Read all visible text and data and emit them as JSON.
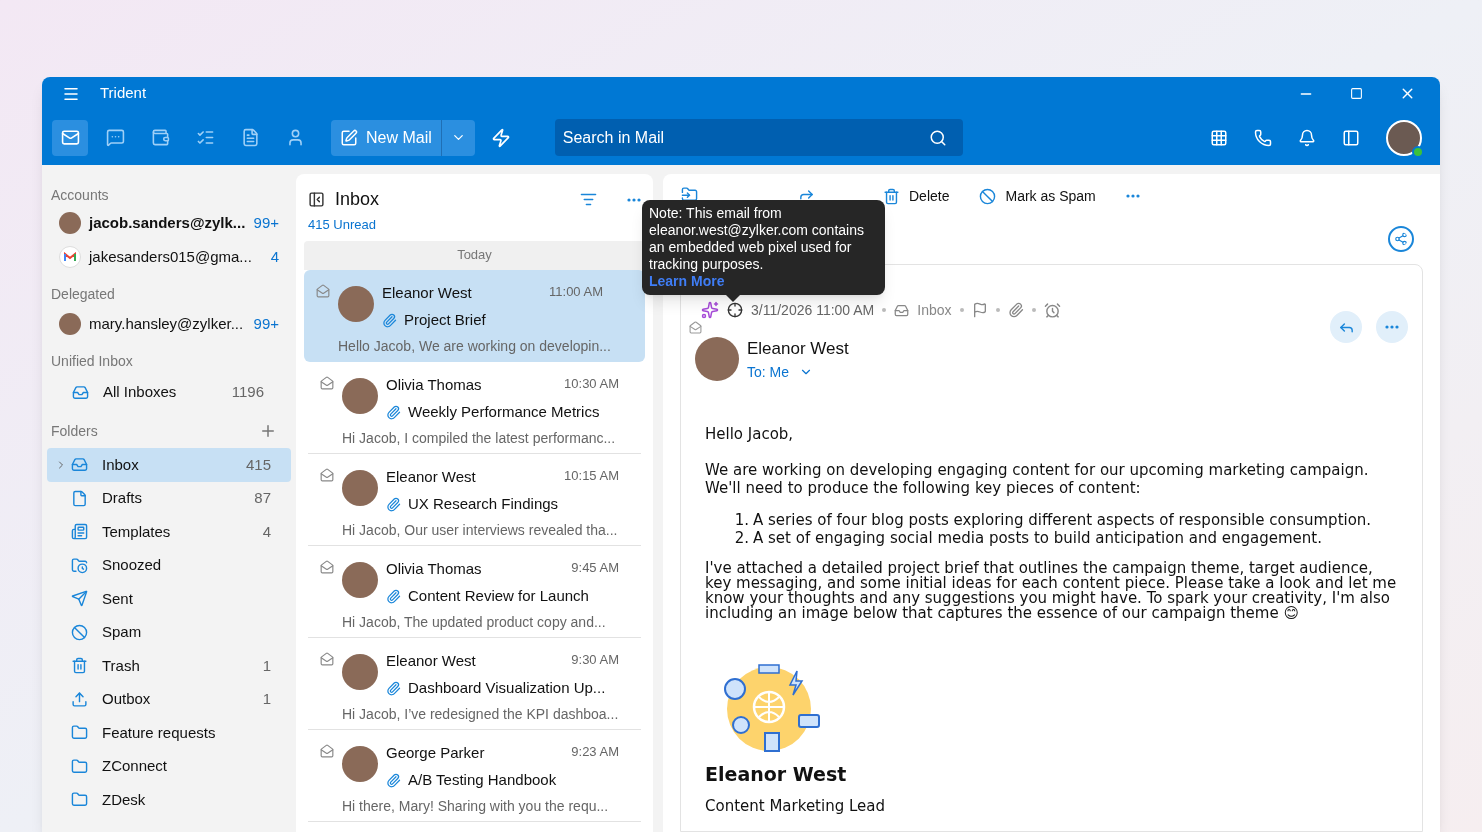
{
  "window": {
    "title": "Trident"
  },
  "toolbar": {
    "apps": [
      {
        "kind": "mail",
        "selected": true
      },
      {
        "kind": "chat",
        "selected": false
      },
      {
        "kind": "wallet",
        "selected": false
      },
      {
        "kind": "tasks",
        "selected": false
      },
      {
        "kind": "notes",
        "selected": false
      },
      {
        "kind": "contacts",
        "selected": false
      }
    ],
    "new_mail": "New Mail",
    "search": {
      "placeholder": "Search in Mail"
    }
  },
  "sidebar": {
    "accounts_heading": "Accounts",
    "accounts": [
      {
        "kind": "avatar",
        "email": "jacob.sanders@zylk...",
        "count": "99+",
        "bold": true
      },
      {
        "kind": "gmail",
        "email": "jakesanders015@gma...",
        "count": "4",
        "bold": false
      }
    ],
    "delegated_heading": "Delegated",
    "delegated": [
      {
        "kind": "avatar",
        "email": "mary.hansley@zylker...",
        "count": "99+",
        "bold": false
      }
    ],
    "unified_heading": "Unified Inbox",
    "unified": [
      {
        "label": "All Inboxes",
        "count": "1196"
      }
    ],
    "folders_heading": "Folders",
    "folders": [
      {
        "kind": "inbox",
        "label": "Inbox",
        "count": "415",
        "selected": true
      },
      {
        "kind": "drafts",
        "label": "Drafts",
        "count": "87",
        "selected": false
      },
      {
        "kind": "templates",
        "label": "Templates",
        "count": "4",
        "selected": false
      },
      {
        "kind": "snoozed",
        "label": "Snoozed",
        "selected": false
      },
      {
        "kind": "sent",
        "label": "Sent",
        "selected": false
      },
      {
        "kind": "spam",
        "label": "Spam",
        "selected": false
      },
      {
        "kind": "trash",
        "label": "Trash",
        "count": "1",
        "selected": false
      },
      {
        "kind": "outbox",
        "label": "Outbox",
        "count": "1",
        "selected": false
      },
      {
        "kind": "folder",
        "label": "Feature requests",
        "selected": false
      },
      {
        "kind": "folder",
        "label": "ZConnect",
        "selected": false
      },
      {
        "kind": "folder",
        "label": "ZDesk",
        "selected": false
      }
    ]
  },
  "mail_list": {
    "title": "Inbox",
    "unread": "415 Unread",
    "group": "Today",
    "messages": [
      {
        "sender": "Eleanor West",
        "time": "11:00 AM",
        "subject": "Project Brief",
        "preview": "Hello Jacob, We are working on developin...",
        "selected": true
      },
      {
        "sender": "Olivia Thomas",
        "time": "10:30 AM",
        "subject": "Weekly Performance Metrics",
        "preview": "Hi Jacob, I compiled the latest performanc...",
        "selected": false
      },
      {
        "sender": "Eleanor West",
        "time": "10:15 AM",
        "subject": "UX Research Findings",
        "preview": "Hi Jacob, Our user interviews revealed tha...",
        "selected": false
      },
      {
        "sender": "Olivia Thomas",
        "time": "9:45 AM",
        "subject": "Content Review for Launch",
        "preview": "Hi Jacob, The updated product copy and...",
        "selected": false
      },
      {
        "sender": "Eleanor West",
        "time": "9:30 AM",
        "subject": "Dashboard Visualization Up...",
        "preview": "Hi Jacob, I’ve redesigned the KPI dashboa...",
        "selected": false
      },
      {
        "sender": "George Parker",
        "time": "9:23 AM",
        "subject": "A/B Testing Handbook",
        "preview": "Hi there, Mary! Sharing with you the requ...",
        "selected": false
      }
    ]
  },
  "reader": {
    "actions": [
      {
        "kind": "delete",
        "label": "Delete"
      },
      {
        "kind": "spam",
        "label": "Mark as Spam"
      }
    ],
    "date": "3/11/2026 11:00 AM",
    "folder": "Inbox",
    "sender": "Eleanor West",
    "to": "To: Me",
    "greeting": "Hello Jacob,",
    "intro": "We are working on developing engaging content for our upcoming marketing campaign. We'll need to produce the following key pieces of content:",
    "list": [
      {
        "number": "1.",
        "text": "A series of four blog posts exploring different aspects of responsible consumption."
      },
      {
        "number": "2.",
        "text": "A set of engaging social media posts to build anticipation and engagement."
      }
    ],
    "closing": "I've attached a detailed project brief that outlines the campaign theme, target audience, key messaging, and some initial ideas for each content piece. Please take a look and let me know your thoughts and any suggestions you might have. To spark your creativity, I'm also including an image below that captures the essence of our campaign theme 😊",
    "signature_name": "Eleanor West",
    "signature_role": "Content Marketing Lead"
  },
  "tooltip": {
    "text": "Note: This email from eleanor.west@zylker.com contains an embedded web pixel used for tracking purposes.",
    "link": "Learn More"
  }
}
